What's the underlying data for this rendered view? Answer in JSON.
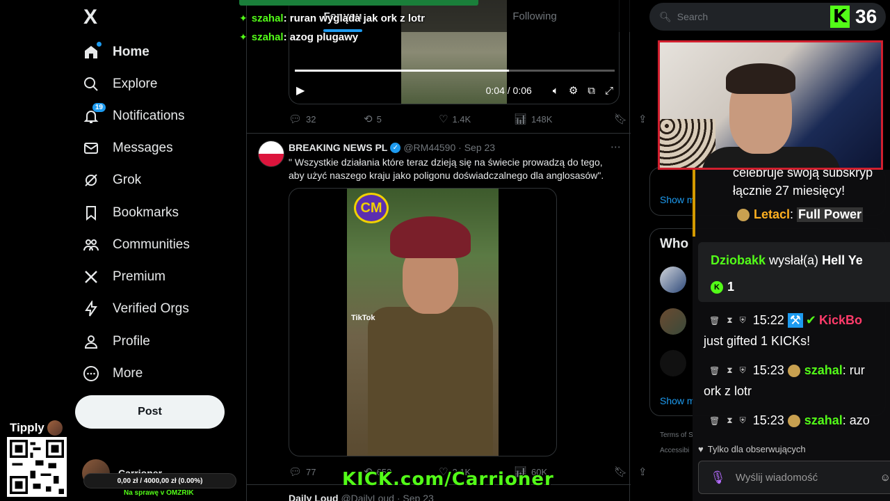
{
  "nav": {
    "logo": "X",
    "items": [
      {
        "label": "Home",
        "icon": "home-icon"
      },
      {
        "label": "Explore",
        "icon": "search-icon"
      },
      {
        "label": "Notifications",
        "icon": "bell-icon",
        "badge": "19"
      },
      {
        "label": "Messages",
        "icon": "envelope-icon"
      },
      {
        "label": "Grok",
        "icon": "grok-icon"
      },
      {
        "label": "Bookmarks",
        "icon": "bookmark-icon"
      },
      {
        "label": "Communities",
        "icon": "people-icon"
      },
      {
        "label": "Premium",
        "icon": "x-icon"
      },
      {
        "label": "Verified Orgs",
        "icon": "lightning-icon"
      },
      {
        "label": "Profile",
        "icon": "person-icon"
      },
      {
        "label": "More",
        "icon": "more-circle-icon"
      }
    ],
    "post_label": "Post",
    "account_name": "Carrioner"
  },
  "feed": {
    "tabs": [
      {
        "label": "For you",
        "active": true
      },
      {
        "label": "Following",
        "active": false
      }
    ],
    "video1": {
      "time": "0:04 / 0:06",
      "progress": 0.67
    },
    "tweet1_actions": {
      "replies": "32",
      "reposts": "5",
      "likes": "1.4K",
      "views": "148K"
    },
    "tweet2": {
      "name": "BREAKING NEWS PL",
      "handle": "@RM44590",
      "date": "Sep 23",
      "text": "\" Wszystkie działania które teraz dzieją się na świecie prowadzą do tego, aby użyć naszego kraju jako poligonu doświadczalnego dla anglosasów\".",
      "media_logo": "CM",
      "media_watermark": "TikTok",
      "actions": {
        "replies": "77",
        "reposts": "652",
        "likes": "2.1K",
        "views": "60K"
      }
    },
    "tweet3": {
      "name": "Daily Loud",
      "handle": "@DailyLoud",
      "date": "Sep 23"
    }
  },
  "sidebar": {
    "search_placeholder": "Search",
    "who_title": "Who",
    "show_more": "Show m",
    "tos": "Terms of S",
    "accessibility": "Accessibi"
  },
  "overlay": {
    "kick_count": "36",
    "top_chat": [
      {
        "user": "szahal",
        "msg": ": ruran wygląda jak ork z lotr"
      },
      {
        "user": "szahal",
        "msg": ": azog plugawy"
      }
    ],
    "chat": {
      "sub_line1": "celebruje swoją subskryp",
      "sub_line2": "łącznie 27 miesięcy!",
      "sub_user": "Letacl",
      "sub_msg": "Full Power",
      "gift_user": "Dziobakk",
      "gift_verb": "wysłał(a)",
      "gift_item": "Hell Ye",
      "gift_count": "1",
      "m1_time": "15:22",
      "m1_user": "KickBo",
      "m1_text": "just gifted 1 KICKs!",
      "m2_time": "15:23",
      "m2_user": "szahal",
      "m2_text1": "rur",
      "m2_text2": "ork z lotr",
      "m3_time": "15:23",
      "m3_user": "szahal",
      "m3_text": "azo",
      "follow_only": "Tylko dla obserwujących",
      "input_placeholder": "Wyślij wiadomość"
    },
    "tipply": "Tipply",
    "donation": "0,00 zł / 4000,00 zł (0.00%)",
    "donation_sub": "Na sprawę v OMZRIK",
    "kick_url": "KICK.com/Carrioner"
  },
  "colors": {
    "accent": "#1d9bf0",
    "kick_green": "#53fc18",
    "cam_border": "#d11f2e"
  }
}
